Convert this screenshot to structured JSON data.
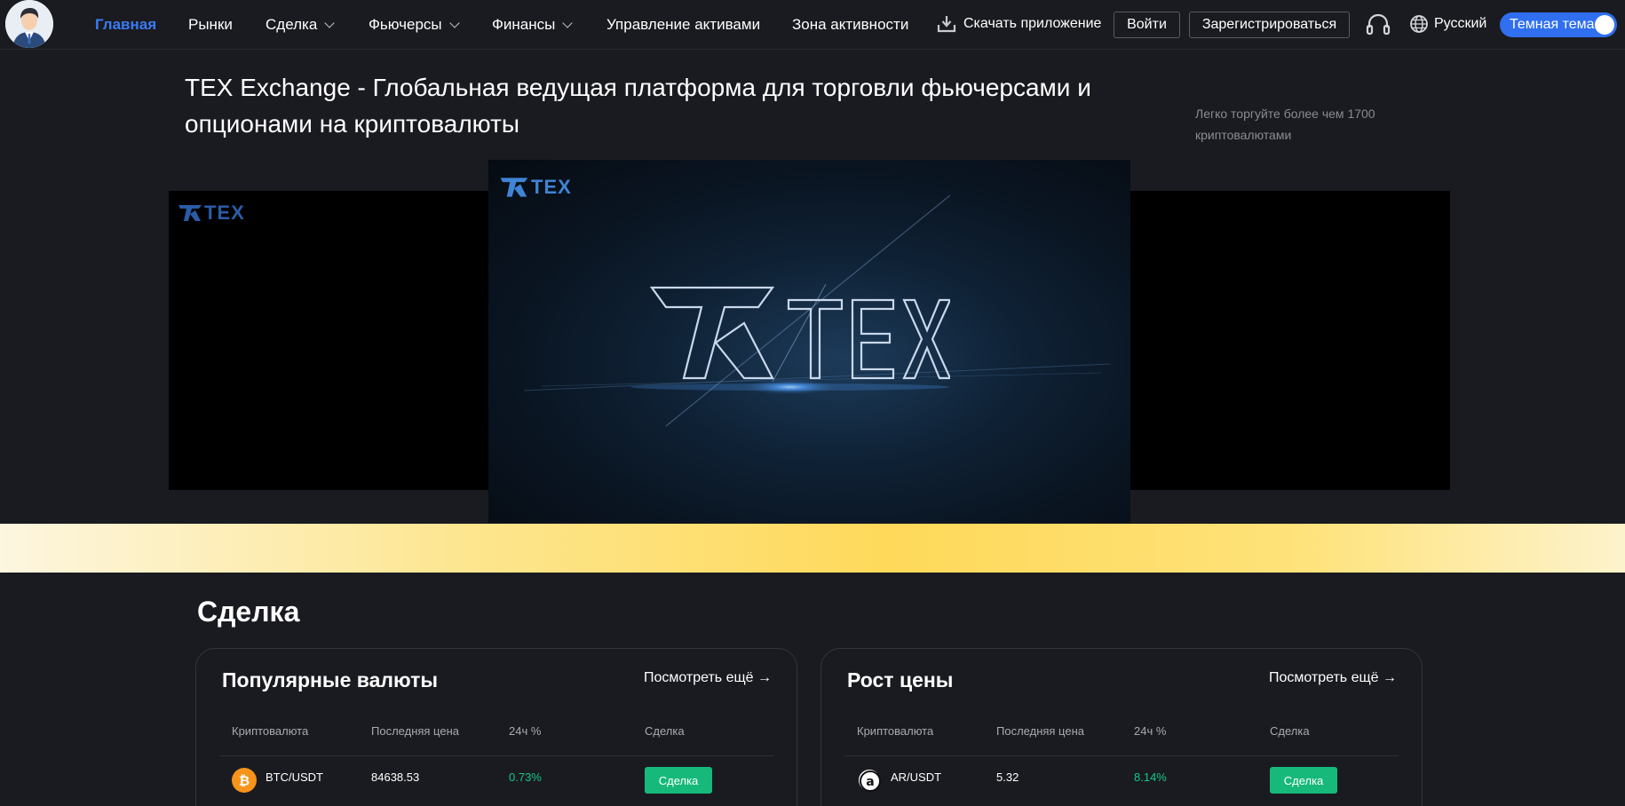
{
  "header": {
    "nav": [
      {
        "label": "Главная",
        "active": true,
        "dropdown": false
      },
      {
        "label": "Рынки",
        "active": false,
        "dropdown": false
      },
      {
        "label": "Сделка",
        "active": false,
        "dropdown": true
      },
      {
        "label": "Фьючерсы",
        "active": false,
        "dropdown": true
      },
      {
        "label": "Финансы",
        "active": false,
        "dropdown": true
      },
      {
        "label": "Управление активами",
        "active": false,
        "dropdown": false
      },
      {
        "label": "Зона активности",
        "active": false,
        "dropdown": false
      }
    ],
    "download_label": "Скачать приложение",
    "login_label": "Войти",
    "register_label": "Зарегистрироваться",
    "language_label": "Русский",
    "theme_label": "Темная тема",
    "theme_on": true
  },
  "hero": {
    "title": "TEX Exchange - Глобальная ведущая платформа для торговли фьючерсами и опционами на криптовалюты",
    "subtitle": "Легко торгуйте более чем 1700 криптовалютами",
    "logo_text": "TEX"
  },
  "section": {
    "title": "Сделка",
    "columns": [
      "Криптовалюта",
      "Последняя цена",
      "24ч %",
      "Сделка"
    ],
    "more_label": "Посмотреть ещё",
    "cards": [
      {
        "title": "Популярные валюты",
        "rows": [
          {
            "pair": "BTC/USDT",
            "price": "84638.53",
            "change": "0.73%",
            "action": "Сделка",
            "icon": "bitcoin-icon",
            "icon_color": "#f7931a"
          }
        ]
      },
      {
        "title": "Рост цены",
        "rows": [
          {
            "pair": "AR/USDT",
            "price": "5.32",
            "change": "8.14%",
            "action": "Сделка",
            "icon": "arweave-icon",
            "icon_color": "#ffffff"
          }
        ]
      }
    ]
  },
  "colors": {
    "accent": "#2f6ff0",
    "active_nav": "#3a7bf5",
    "positive": "#17c684",
    "trade_button": "#17b97a",
    "background": "#1a1b20"
  }
}
